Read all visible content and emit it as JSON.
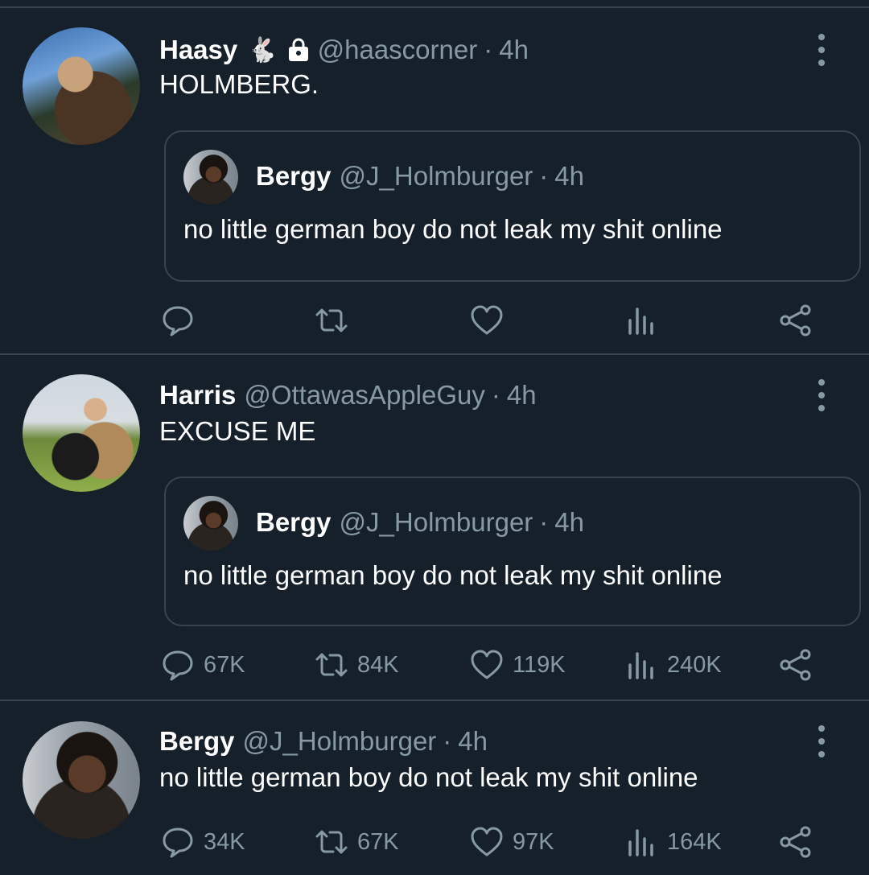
{
  "tweets": [
    {
      "name": "Haasy",
      "emoji": "🐇",
      "handle": "@haascorner",
      "time": "4h",
      "text": "HOLMBERG.",
      "quote": {
        "name": "Bergy",
        "handle": "@J_Holmburger",
        "time": "4h",
        "text": "no little german boy do not leak my shit online"
      },
      "counts": {
        "reply": "",
        "retweet": "",
        "like": "",
        "views": ""
      }
    },
    {
      "name": "Harris",
      "handle": "@OttawasAppleGuy",
      "time": "4h",
      "text": "EXCUSE ME",
      "quote": {
        "name": "Bergy",
        "handle": "@J_Holmburger",
        "time": "4h",
        "text": "no little german boy do not leak my shit online"
      },
      "counts": {
        "reply": "67K",
        "retweet": "84K",
        "like": "119K",
        "views": "240K"
      }
    },
    {
      "name": "Bergy",
      "handle": "@J_Holmburger",
      "time": "4h",
      "text": "no little german boy do not leak my shit online",
      "counts": {
        "reply": "34K",
        "retweet": "67K",
        "like": "97K",
        "views": "164K"
      }
    }
  ],
  "separator": "·",
  "icons": [
    "reply-icon",
    "retweet-icon",
    "like-icon",
    "views-icon",
    "share-icon",
    "more-icon",
    "lock-icon"
  ],
  "colors": {
    "background": "#15202b",
    "muted": "#8899a6",
    "border": "#38444d",
    "text": "#ffffff"
  }
}
